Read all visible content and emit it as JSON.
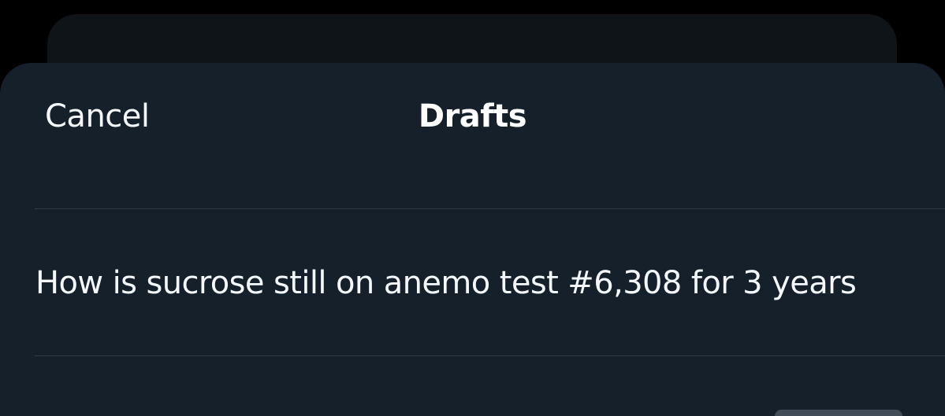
{
  "header": {
    "cancel_label": "Cancel",
    "title": "Drafts"
  },
  "drafts": [
    {
      "text": "How is sucrose still on anemo test #6,308 for 3 years"
    }
  ],
  "colors": {
    "background": "#000000",
    "sheet": "#15202b",
    "back_sheet": "#0f1419",
    "divider": "#2f3b47",
    "text": "#f5f8fa"
  }
}
